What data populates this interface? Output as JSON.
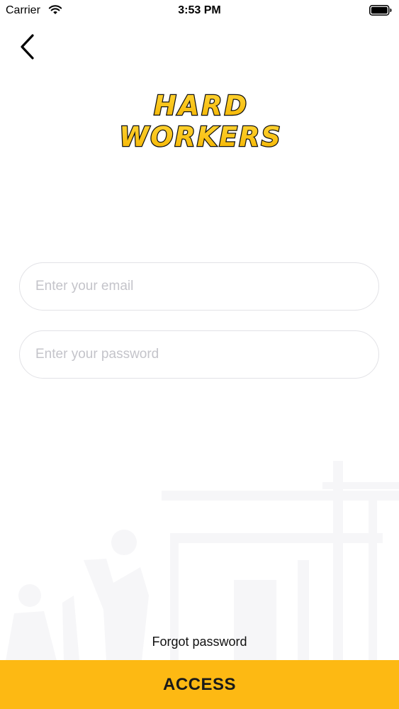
{
  "status_bar": {
    "carrier": "Carrier",
    "time": "3:53 PM",
    "icons": [
      "wifi-icon",
      "battery-icon"
    ]
  },
  "nav": {
    "back_icon": "chevron-left-icon"
  },
  "logo": {
    "line1": "HARD",
    "line2": "WORKERS",
    "fill_color": "#fdc20f",
    "outline_color": "#111111"
  },
  "form": {
    "email_placeholder": "Enter your email",
    "email_value": "",
    "password_placeholder": "Enter your password",
    "password_value": ""
  },
  "forgot_password_label": "Forgot password",
  "access_label": "ACCESS",
  "colors": {
    "accent": "#fdb913",
    "field_border": "#e2e2e6",
    "placeholder": "#c4c4ca",
    "background_art": "#f6f6f8"
  }
}
